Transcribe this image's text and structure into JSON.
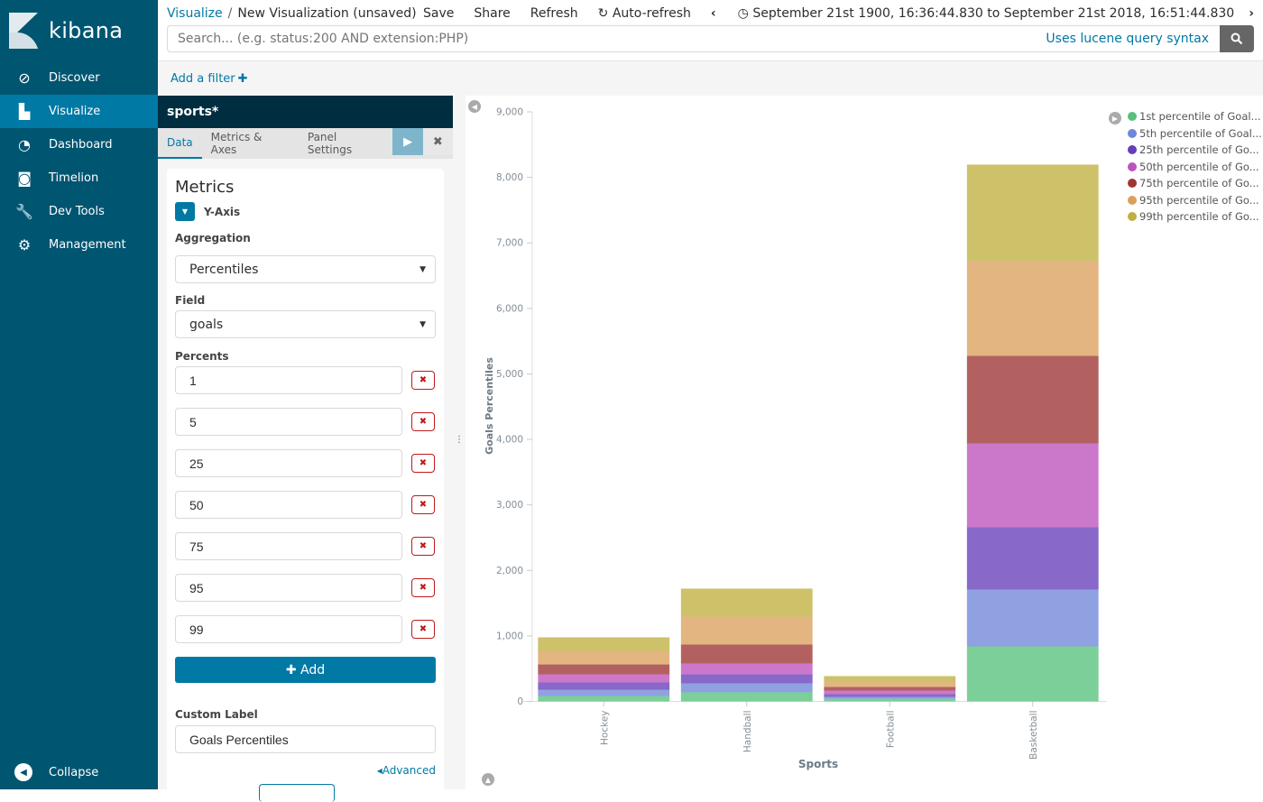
{
  "sidebar": {
    "brand": "kibana",
    "items": [
      {
        "label": "Discover",
        "icon": "compass-icon",
        "glyph": "⊘",
        "active": false
      },
      {
        "label": "Visualize",
        "icon": "bar-chart-icon",
        "glyph": "▙",
        "active": true
      },
      {
        "label": "Dashboard",
        "icon": "dashboard-gauge-icon",
        "glyph": "◔",
        "active": false
      },
      {
        "label": "Timelion",
        "icon": "timelion-bear-icon",
        "glyph": "◙",
        "active": false
      },
      {
        "label": "Dev Tools",
        "icon": "wrench-icon",
        "glyph": "🔧",
        "active": false
      },
      {
        "label": "Management",
        "icon": "gear-icon",
        "glyph": "⚙",
        "active": false
      }
    ],
    "collapse_label": "Collapse"
  },
  "header": {
    "breadcrumb_root": "Visualize",
    "breadcrumb_separator": "/",
    "breadcrumb_current": "New Visualization (unsaved)",
    "actions": {
      "save": "Save",
      "share": "Share",
      "refresh": "Refresh",
      "auto_refresh": "Auto-refresh"
    },
    "time_range": "September 21st 1900, 16:36:44.830 to September 21st 2018, 16:51:44.830"
  },
  "search": {
    "placeholder": "Search... (e.g. status:200 AND extension:PHP)",
    "value": "",
    "syntax_link": "Uses lucene query syntax"
  },
  "filter_bar": {
    "add_filter_label": "Add a filter"
  },
  "editor": {
    "index_pattern": "sports*",
    "tabs": [
      {
        "label": "Data",
        "active": true
      },
      {
        "label": "Metrics & Axes",
        "active": false
      },
      {
        "label": "Panel Settings",
        "active": false
      }
    ],
    "metrics_title": "Metrics",
    "metric_name": "Y-Axis",
    "aggregation_label": "Aggregation",
    "aggregation_value": "Percentiles",
    "field_label": "Field",
    "field_value": "goals",
    "percents_label": "Percents",
    "percents": [
      "1",
      "5",
      "25",
      "50",
      "75",
      "95",
      "99"
    ],
    "add_label": "Add",
    "custom_label_label": "Custom Label",
    "custom_label_value": "Goals Percentiles",
    "advanced_label": "Advanced"
  },
  "chart_data": {
    "type": "bar",
    "stacked": true,
    "title": "",
    "xlabel": "Sports",
    "ylabel": "Goals Percentiles",
    "ylim": [
      0,
      9000
    ],
    "yticks": [
      0,
      1000,
      2000,
      3000,
      4000,
      5000,
      6000,
      7000,
      8000,
      9000
    ],
    "ytick_labels": [
      "0",
      "1,000",
      "2,000",
      "3,000",
      "4,000",
      "5,000",
      "6,000",
      "7,000",
      "8,000",
      "9,000"
    ],
    "grid": false,
    "legend_position": "top-right",
    "categories": [
      "Hockey",
      "Handball",
      "Football",
      "Basketball"
    ],
    "series": [
      {
        "name": "1st percentile of Goal...",
        "color": "#57c17b",
        "values": [
          83,
          138,
          41,
          840
        ]
      },
      {
        "name": "5th percentile of Goal...",
        "color": "#6f87d8",
        "values": [
          96,
          138,
          28,
          868
        ]
      },
      {
        "name": "25th percentile of Go...",
        "color": "#663db8",
        "values": [
          110,
          138,
          41,
          950
        ]
      },
      {
        "name": "50th percentile of Go...",
        "color": "#bc52bc",
        "values": [
          124,
          165,
          55,
          1281
        ]
      },
      {
        "name": "75th percentile of Go...",
        "color": "#9e3533",
        "values": [
          151,
          289,
          55,
          1336
        ]
      },
      {
        "name": "95th percentile of Go...",
        "color": "#daa05d",
        "values": [
          207,
          427,
          83,
          1446
        ]
      },
      {
        "name": "99th percentile of Go...",
        "color": "#bfaf40",
        "values": [
          207,
          427,
          83,
          1474
        ]
      }
    ]
  },
  "colors": {
    "sidebar_bg": "#005571",
    "sidebar_active": "#0079a5",
    "accent": "#0079a5",
    "index_header_bg": "#002d3f",
    "danger": "#bf1a1a"
  }
}
